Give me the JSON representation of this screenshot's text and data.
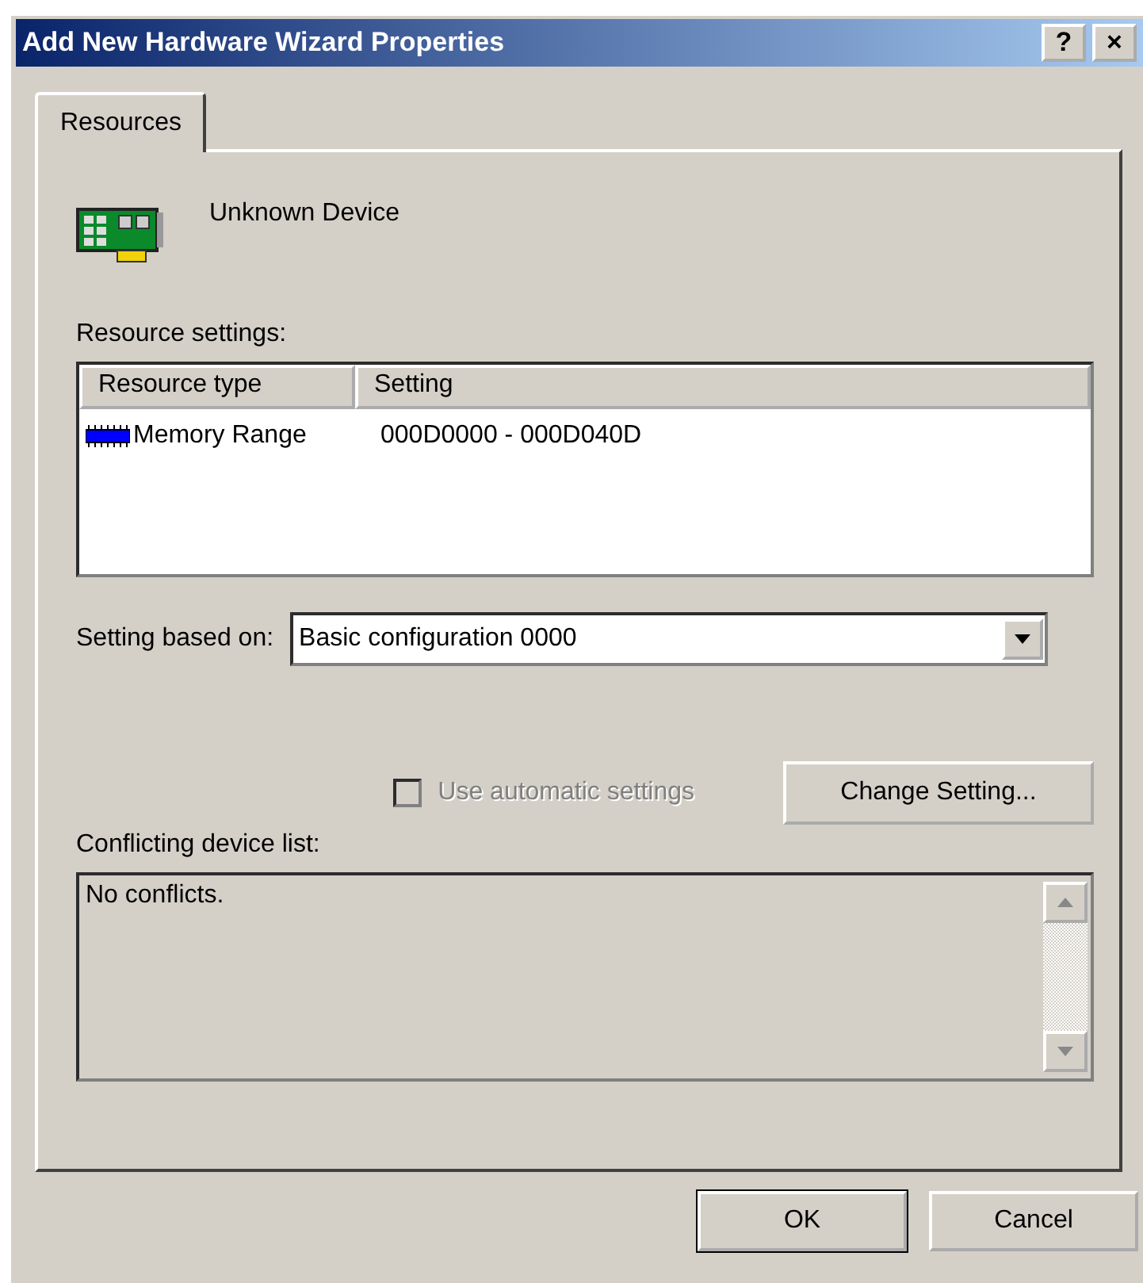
{
  "window": {
    "title": "Add New Hardware Wizard Properties",
    "title_buttons": [
      "?",
      "×"
    ]
  },
  "tabs": [
    {
      "label": "Resources",
      "selected": true
    }
  ],
  "device": {
    "name": "Unknown Device"
  },
  "resource_settings": {
    "label": "Resource settings:",
    "columns": [
      "Resource type",
      "Setting"
    ],
    "rows": [
      {
        "type": "Memory Range",
        "setting": "000D0000 - 000D040D"
      }
    ]
  },
  "setting_based_on": {
    "label": "Setting based on:",
    "value": "Basic configuration 0000"
  },
  "automatic": {
    "label": "Use automatic settings",
    "checked": false,
    "disabled": true
  },
  "change_button": {
    "label": "Change Setting...",
    "disabled": false
  },
  "conflicts": {
    "label": "Conflicting device list:",
    "text": "No conflicts."
  },
  "buttons": [
    "OK",
    "Cancel"
  ]
}
